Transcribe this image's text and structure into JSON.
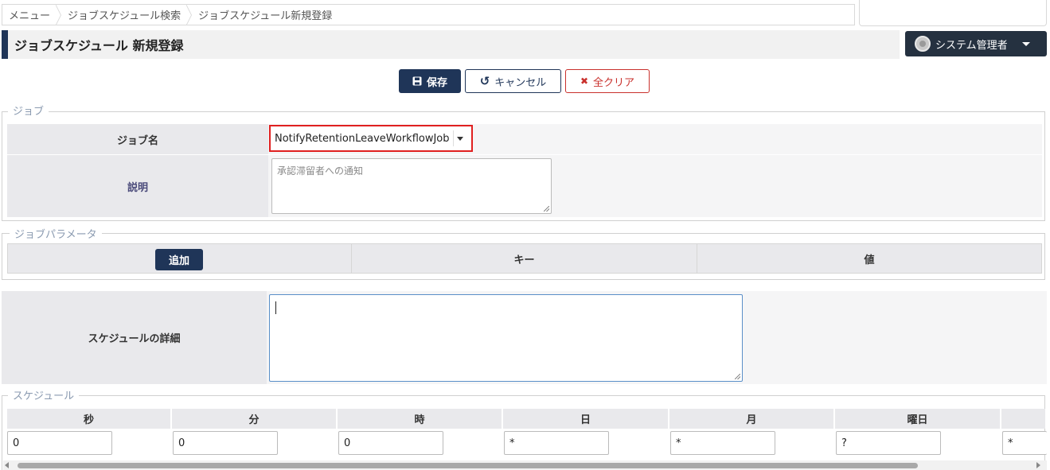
{
  "breadcrumb": [
    "メニュー",
    "ジョブスケジュール検索",
    "ジョブスケジュール新規登録"
  ],
  "page_title": "ジョブスケジュール 新規登録",
  "user_menu": {
    "label": "システム管理者",
    "icon": "user-avatar-icon"
  },
  "toolbar": {
    "save_label": "保存",
    "cancel_label": "キャンセル",
    "clear_label": "全クリア"
  },
  "job_section": {
    "legend": "ジョブ",
    "job_name_label": "ジョブ名",
    "job_name_value": "NotifyRetentionLeaveWorkflowJob",
    "description_label": "説明",
    "description_value": "承認滞留者への通知"
  },
  "param_section": {
    "legend": "ジョブパラメータ",
    "add_label": "追加",
    "key_header": "キー",
    "value_header": "値"
  },
  "schedule_detail": {
    "label": "スケジュールの詳細",
    "value": ""
  },
  "schedule_section": {
    "legend": "スケジュール",
    "headers": [
      "秒",
      "分",
      "時",
      "日",
      "月",
      "曜日",
      ""
    ],
    "values": [
      "0",
      "0",
      "0",
      "*",
      "*",
      "?",
      "*"
    ]
  },
  "colors": {
    "primary": "#1f3558",
    "danger": "#c9302c",
    "highlight_border": "#e02020"
  }
}
